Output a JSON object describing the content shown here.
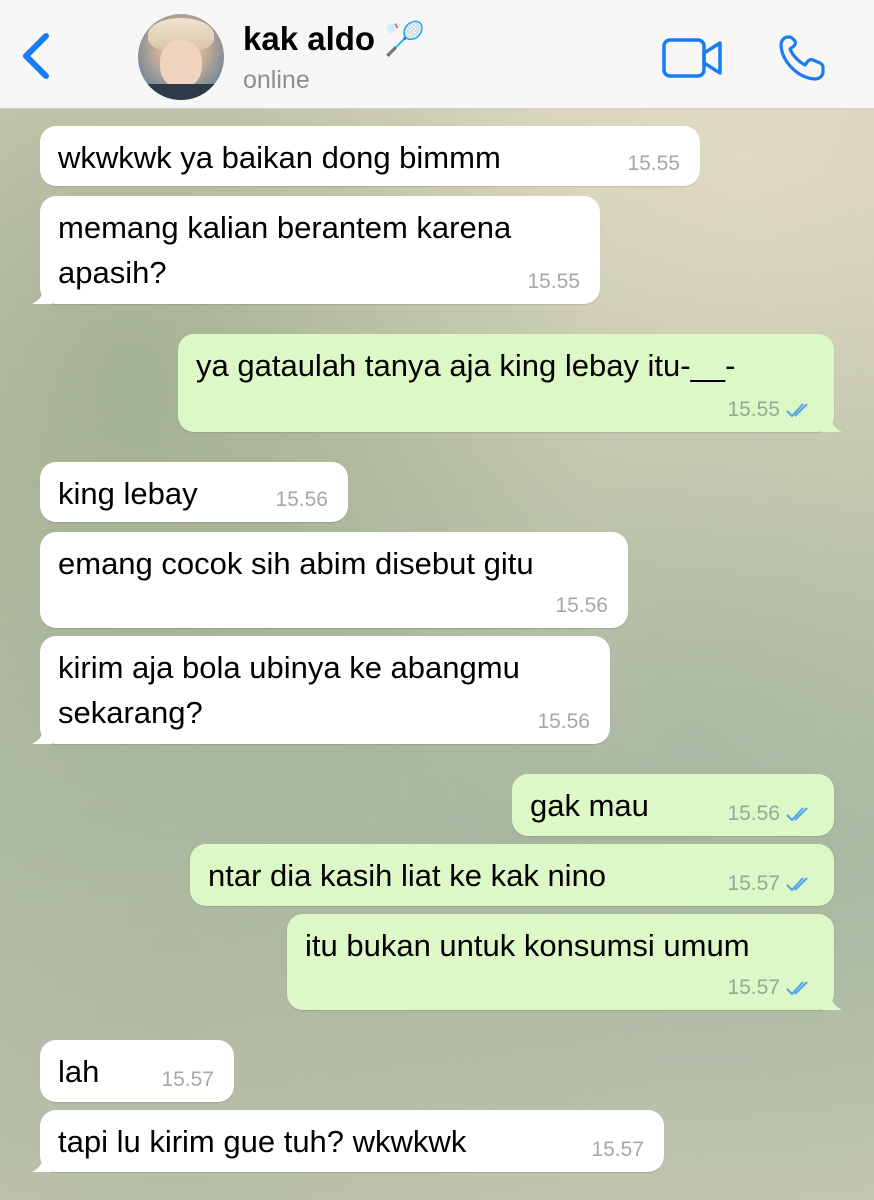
{
  "header": {
    "contact_name": "kak aldo 🏸",
    "status": "online"
  },
  "icons": {
    "back": "chevron-left-icon",
    "video": "video-camera-icon",
    "call": "phone-icon",
    "read": "double-check-icon"
  },
  "colors": {
    "accent": "#1a7cf5",
    "incoming_bubble": "#ffffff",
    "outgoing_bubble": "#dcf8c6",
    "read_ticks": "#4fa3f0"
  },
  "messages": [
    {
      "direction": "in",
      "lines": [
        "wkwkwk ya baikan dong bimmm"
      ],
      "time": "15.55"
    },
    {
      "direction": "in",
      "lines": [
        "memang kalian berantem karena",
        "apasih?"
      ],
      "time": "15.55"
    },
    {
      "direction": "out",
      "lines": [
        "ya gataulah tanya aja king lebay itu-__-"
      ],
      "time": "15.55"
    },
    {
      "direction": "in",
      "lines": [
        "king lebay"
      ],
      "time": "15.56"
    },
    {
      "direction": "in",
      "lines": [
        "emang cocok sih abim disebut gitu"
      ],
      "time": "15.56"
    },
    {
      "direction": "in",
      "lines": [
        "kirim aja bola ubinya ke abangmu",
        "sekarang?"
      ],
      "time": "15.56"
    },
    {
      "direction": "out",
      "lines": [
        "gak mau"
      ],
      "time": "15.56"
    },
    {
      "direction": "out",
      "lines": [
        "ntar dia kasih liat ke kak nino"
      ],
      "time": "15.57"
    },
    {
      "direction": "out",
      "lines": [
        "itu bukan untuk konsumsi umum"
      ],
      "time": "15.57"
    },
    {
      "direction": "in",
      "lines": [
        "lah"
      ],
      "time": "15.57"
    },
    {
      "direction": "in",
      "lines": [
        "tapi lu kirim gue tuh? wkwkwk"
      ],
      "time": "15.57"
    }
  ]
}
